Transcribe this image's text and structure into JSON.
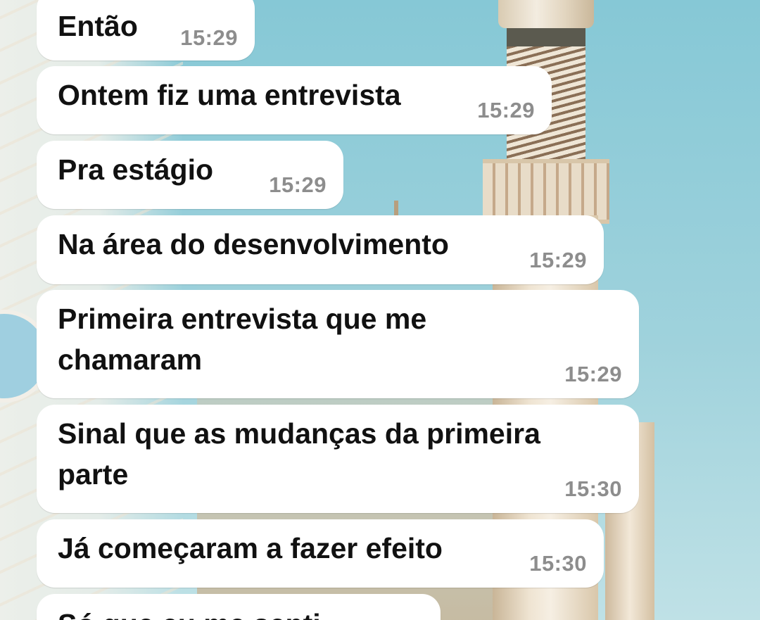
{
  "conversation": {
    "messages": [
      {
        "text": "Então",
        "time": "15:29"
      },
      {
        "text": "Ontem fiz uma entrevista",
        "time": "15:29"
      },
      {
        "text": "Pra estágio",
        "time": "15:29"
      },
      {
        "text": "Na área do desenvolvimento",
        "time": "15:29"
      },
      {
        "text": "Primeira entrevista que me\nchamaram",
        "time": "15:29"
      },
      {
        "text": "Sinal que as mudanças da primeira\nparte",
        "time": "15:30"
      },
      {
        "text": "Já começaram a fazer efeito",
        "time": "15:30"
      },
      {
        "text": "Só que eu me senti",
        "time": ""
      }
    ]
  },
  "colors": {
    "bubble": "#ffffff",
    "text": "#111111",
    "time": "#8d8d8d",
    "sky": "#86c8d6"
  }
}
